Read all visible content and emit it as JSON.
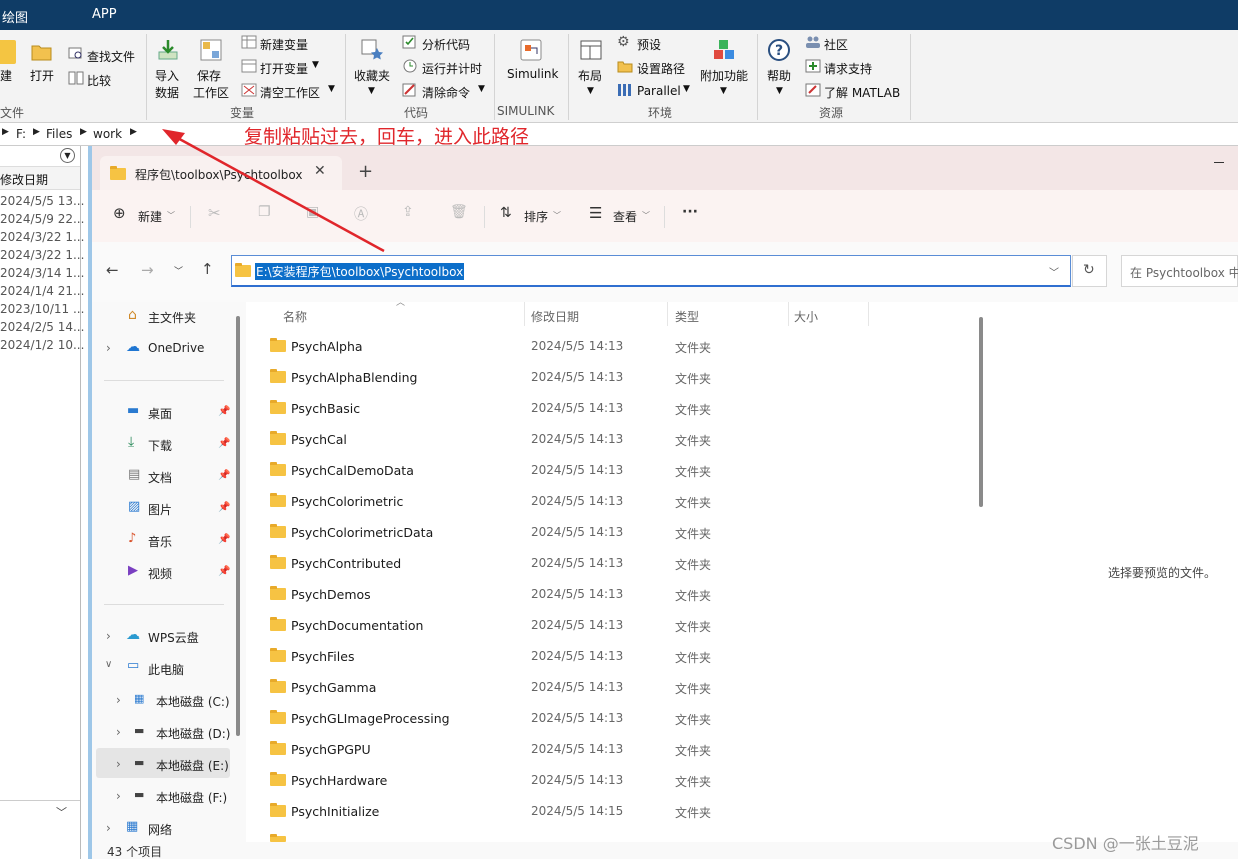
{
  "matlab": {
    "tabs": [
      "绘图",
      "APP"
    ],
    "ribbon": {
      "file": {
        "new": "建",
        "open": "打开",
        "find_files": "查找文件",
        "compare": "比较",
        "group": "文件"
      },
      "variable": {
        "import": "导入\n数据",
        "import_l1": "导入",
        "import_l2": "数据",
        "save_l1": "保存",
        "save_l2": "工作区",
        "new_var": "新建变量",
        "open_var": "打开变量",
        "clear_ws": "清空工作区",
        "group": "变量"
      },
      "code": {
        "favorites": "收藏夹",
        "analyze": "分析代码",
        "run_time": "运行并计时",
        "clear_cmd": "清除命令",
        "group": "代码"
      },
      "simulink": {
        "label": "Simulink",
        "group": "SIMULINK"
      },
      "env": {
        "layout": "布局",
        "prefs": "预设",
        "set_path": "设置路径",
        "parallel": "Parallel",
        "addons": "附加功能",
        "group": "环境"
      },
      "resources": {
        "help": "帮助",
        "community": "社区",
        "support": "请求支持",
        "learn": "了解 MATLAB",
        "group": "资源"
      }
    },
    "address": {
      "parts": [
        "F:",
        "Files",
        "work"
      ]
    },
    "left_panel": {
      "header": "修改日期",
      "dates": [
        "2024/5/5 13...",
        "2024/5/9 22...",
        "2024/3/22 1...",
        "2024/3/22 1...",
        "2024/3/14 1...",
        "2024/1/4 21...",
        "2023/10/11 ...",
        "2024/2/5 14...",
        "2024/1/2 10..."
      ]
    }
  },
  "annotation": "复制粘贴过去，回车，进入此路径",
  "explorer": {
    "tab_title": "程序包\\toolbox\\Psychtoolbox",
    "toolbar": {
      "new": "新建",
      "sort": "排序",
      "view": "查看",
      "more": "···"
    },
    "address": "E:\\安装程序包\\toolbox\\Psychtoolbox",
    "search_placeholder": "在 Psychtoolbox 中",
    "nav": {
      "home": "主文件夹",
      "onedrive": "OneDrive",
      "desktop": "桌面",
      "downloads": "下载",
      "documents": "文档",
      "pictures": "图片",
      "music": "音乐",
      "videos": "视频",
      "wps": "WPS云盘",
      "this_pc": "此电脑",
      "drive_c": "本地磁盘 (C:)",
      "drive_d": "本地磁盘 (D:)",
      "drive_e": "本地磁盘 (E:)",
      "drive_f": "本地磁盘 (F:)",
      "network": "网络"
    },
    "columns": {
      "name": "名称",
      "modified": "修改日期",
      "type": "类型",
      "size": "大小"
    },
    "rows": [
      {
        "name": "PsychAlpha",
        "date": "2024/5/5 14:13",
        "type": "文件夹"
      },
      {
        "name": "PsychAlphaBlending",
        "date": "2024/5/5 14:13",
        "type": "文件夹"
      },
      {
        "name": "PsychBasic",
        "date": "2024/5/5 14:13",
        "type": "文件夹"
      },
      {
        "name": "PsychCal",
        "date": "2024/5/5 14:13",
        "type": "文件夹"
      },
      {
        "name": "PsychCalDemoData",
        "date": "2024/5/5 14:13",
        "type": "文件夹"
      },
      {
        "name": "PsychColorimetric",
        "date": "2024/5/5 14:13",
        "type": "文件夹"
      },
      {
        "name": "PsychColorimetricData",
        "date": "2024/5/5 14:13",
        "type": "文件夹"
      },
      {
        "name": "PsychContributed",
        "date": "2024/5/5 14:13",
        "type": "文件夹"
      },
      {
        "name": "PsychDemos",
        "date": "2024/5/5 14:13",
        "type": "文件夹"
      },
      {
        "name": "PsychDocumentation",
        "date": "2024/5/5 14:13",
        "type": "文件夹"
      },
      {
        "name": "PsychFiles",
        "date": "2024/5/5 14:13",
        "type": "文件夹"
      },
      {
        "name": "PsychGamma",
        "date": "2024/5/5 14:13",
        "type": "文件夹"
      },
      {
        "name": "PsychGLImageProcessing",
        "date": "2024/5/5 14:13",
        "type": "文件夹"
      },
      {
        "name": "PsychGPGPU",
        "date": "2024/5/5 14:13",
        "type": "文件夹"
      },
      {
        "name": "PsychHardware",
        "date": "2024/5/5 14:13",
        "type": "文件夹"
      },
      {
        "name": "PsychInitialize",
        "date": "2024/5/5 14:15",
        "type": "文件夹"
      }
    ],
    "preview_text": "选择要预览的文件。",
    "status": "43 个项目"
  },
  "watermark": "CSDN @一张土豆泥",
  "colors": {
    "matlab_bar": "#0f3c66",
    "annotation": "#e0262b",
    "folder": "#f6c343",
    "selection": "#2f6fd0"
  }
}
